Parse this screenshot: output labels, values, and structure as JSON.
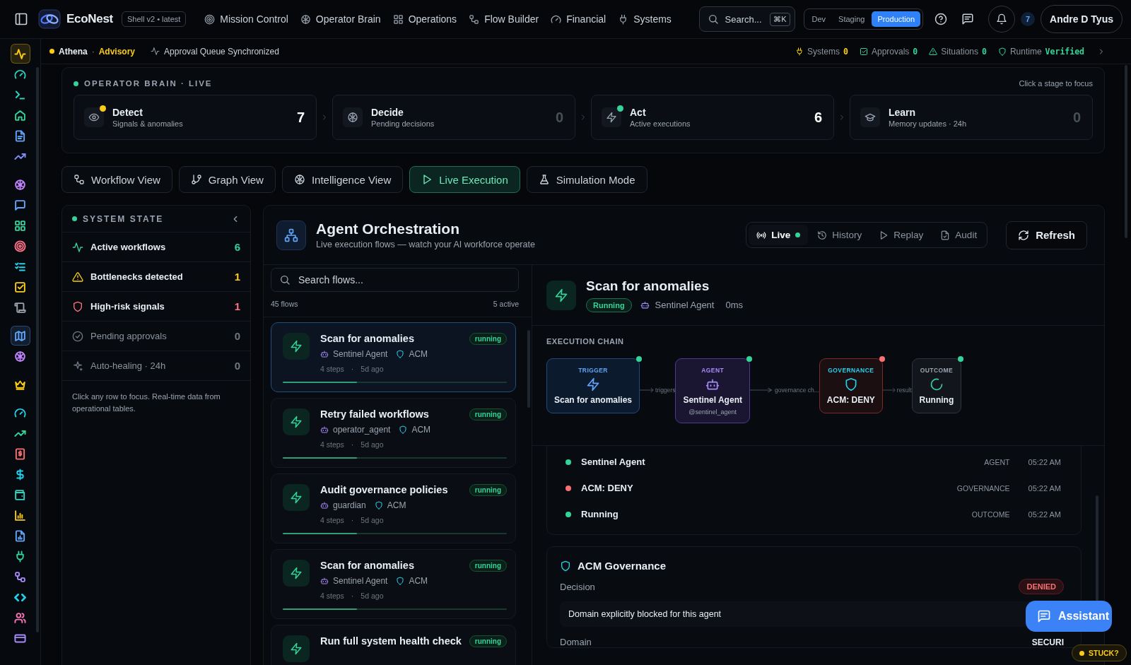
{
  "header": {
    "brand": "EcoNest",
    "build_badge": "Shell v2 • latest",
    "nav": [
      {
        "label": "Mission Control"
      },
      {
        "label": "Operator Brain"
      },
      {
        "label": "Operations"
      },
      {
        "label": "Flow Builder"
      },
      {
        "label": "Financial"
      },
      {
        "label": "Systems"
      }
    ],
    "search": {
      "placeholder": "Search...",
      "shortcut": "⌘K"
    },
    "environments": [
      {
        "label": "Dev",
        "selected": false
      },
      {
        "label": "Staging",
        "selected": false
      },
      {
        "label": "Production",
        "selected": true
      }
    ],
    "notification_count": "7",
    "user": "Andre D Tyus"
  },
  "rail": {
    "groups": [
      {
        "items": [
          {
            "color": "#facc15",
            "selected": true
          },
          {
            "color": "#2dd4bf",
            "selected": false
          },
          {
            "color": "#2dd4bf",
            "selected": false
          },
          {
            "color": "#34d399",
            "selected": false
          },
          {
            "color": "#60a5fa",
            "selected": false
          },
          {
            "color": "#818cf8",
            "selected": false
          }
        ]
      },
      {
        "items": [
          {
            "color": "#c084fc",
            "selected": false
          },
          {
            "color": "#60a5fa",
            "selected": false
          },
          {
            "color": "#34d399",
            "selected": false
          },
          {
            "color": "#fb7185",
            "selected": false
          },
          {
            "color": "#22d3ee",
            "selected": false
          },
          {
            "color": "#facc15",
            "selected": false
          },
          {
            "color": "#9ca3af",
            "selected": false
          }
        ]
      },
      {
        "items": [
          {
            "color": "#60a5fa",
            "selected": true
          },
          {
            "color": "#c084fc",
            "selected": false
          }
        ]
      },
      {
        "items": [
          {
            "color": "#facc15",
            "selected": false
          }
        ]
      },
      {
        "items": [
          {
            "color": "#22d3ee",
            "selected": false
          },
          {
            "color": "#34d399",
            "selected": false
          },
          {
            "color": "#f87171",
            "selected": false
          },
          {
            "color": "#22d3ee",
            "selected": false
          },
          {
            "color": "#2dd4bf",
            "selected": false
          },
          {
            "color": "#facc15",
            "selected": false
          },
          {
            "color": "#60a5fa",
            "selected": false
          },
          {
            "color": "#34d399",
            "selected": false
          },
          {
            "color": "#a78bfa",
            "selected": false
          },
          {
            "color": "#22d3ee",
            "selected": false
          },
          {
            "color": "#f472b6",
            "selected": false
          },
          {
            "color": "#a78bfa",
            "selected": false
          }
        ]
      }
    ]
  },
  "status": {
    "agent": "Athena",
    "separator": "·",
    "mode": "Advisory",
    "sync": "Approval Queue Synchronized",
    "counters": [
      {
        "label": "Systems",
        "value": "0",
        "color": "#facc15"
      },
      {
        "label": "Approvals",
        "value": "0",
        "color": "#34d399"
      },
      {
        "label": "Situations",
        "value": "0",
        "color": "#34d399"
      },
      {
        "label": "Runtime",
        "value": "Verified",
        "color": "#34d399"
      }
    ]
  },
  "brain": {
    "title": "OPERATOR BRAIN · LIVE",
    "hint": "Click a stage to focus",
    "stages": [
      {
        "title": "Detect",
        "subtitle": "Signals & anomalies",
        "count": "7",
        "active": true,
        "color": "#facc15"
      },
      {
        "title": "Decide",
        "subtitle": "Pending decisions",
        "count": "0",
        "active": false
      },
      {
        "title": "Act",
        "subtitle": "Active executions",
        "count": "6",
        "active": true,
        "color": "#34d399"
      },
      {
        "title": "Learn",
        "subtitle": "Memory updates · 24h",
        "count": "0",
        "active": false
      }
    ]
  },
  "views": [
    {
      "label": "Workflow View",
      "selected": false
    },
    {
      "label": "Graph View",
      "selected": false
    },
    {
      "label": "Intelligence View",
      "selected": false
    },
    {
      "label": "Live Execution",
      "selected": true
    },
    {
      "label": "Simulation Mode",
      "selected": false
    }
  ],
  "system_state": {
    "title": "SYSTEM STATE",
    "rows": [
      {
        "label": "Active workflows",
        "count": "6",
        "color": "#34d399",
        "highlighted": true
      },
      {
        "label": "Bottlenecks detected",
        "count": "1",
        "color": "#facc15",
        "highlighted": true
      },
      {
        "label": "High-risk signals",
        "count": "1",
        "color": "#fb7185",
        "highlighted": true
      },
      {
        "label": "Pending approvals",
        "count": "0",
        "color": "#6e7681",
        "highlighted": false
      },
      {
        "label": "Auto-healing · 24h",
        "count": "0",
        "color": "#6e7681",
        "highlighted": false
      }
    ],
    "note": "Click any row to focus. Real-time data from operational tables."
  },
  "orchestration": {
    "title": "Agent Orchestration",
    "subtitle": "Live execution flows — watch your AI workforce operate",
    "modes": [
      {
        "label": "Live",
        "selected": true
      },
      {
        "label": "History",
        "selected": false
      },
      {
        "label": "Replay",
        "selected": false
      },
      {
        "label": "Audit",
        "selected": false
      }
    ],
    "refresh": "Refresh"
  },
  "flows": {
    "search_placeholder": "Search flows...",
    "total": "45 flows",
    "active": "5 active",
    "items": [
      {
        "title": "Scan for anomalies",
        "status": "running",
        "agent": "Sentinel Agent",
        "policy": "ACM",
        "steps": "4 steps",
        "separator": "·",
        "age": "5d ago",
        "level": 0.33,
        "selected": true
      },
      {
        "title": "Retry failed workflows",
        "status": "running",
        "agent": "operator_agent",
        "policy": "ACM",
        "steps": "4 steps",
        "separator": "·",
        "age": "5d ago",
        "level": 0.33,
        "selected": false
      },
      {
        "title": "Audit governance policies",
        "status": "running",
        "agent": "guardian",
        "policy": "ACM",
        "steps": "4 steps",
        "separator": "·",
        "age": "5d ago",
        "level": 0.33,
        "selected": false
      },
      {
        "title": "Scan for anomalies",
        "status": "running",
        "agent": "Sentinel Agent",
        "policy": "ACM",
        "steps": "4 steps",
        "separator": "·",
        "age": "5d ago",
        "level": 0.33,
        "selected": false
      },
      {
        "title": "Run full system health check",
        "status": "running",
        "selected": false
      }
    ]
  },
  "detail": {
    "title": "Scan for anomalies",
    "status": "Running",
    "agent": "Sentinel Agent",
    "duration": "0ms",
    "chain_title": "EXECUTION CHAIN",
    "chain": [
      {
        "kind": "trigger",
        "label": "TRIGGER",
        "title": "Scan for anomalies",
        "color": "#34d399"
      },
      {
        "kind": "agent",
        "label": "AGENT",
        "title": "Sentinel Agent",
        "handle": "@sentinel_agent",
        "color": "#34d399"
      },
      {
        "kind": "governance",
        "label": "GOVERNANCE",
        "title": "ACM: DENY",
        "color": "#f87171"
      },
      {
        "kind": "outcome",
        "label": "OUTCOME",
        "title": "Running",
        "color": "#34d399"
      }
    ],
    "links": [
      "triggers",
      "governance ch...",
      "result"
    ],
    "timeline": [
      {
        "title": "Sentinel Agent",
        "type": "AGENT",
        "time": "05:22 AM",
        "color": "#34d399"
      },
      {
        "title": "ACM: DENY",
        "type": "GOVERNANCE",
        "time": "05:22 AM",
        "color": "#f87171"
      },
      {
        "title": "Running",
        "type": "OUTCOME",
        "time": "05:22 AM",
        "color": "#34d399"
      }
    ],
    "governance": {
      "title": "ACM Governance",
      "decision_label": "Decision",
      "decision": "DENIED",
      "reason": "Domain explicitly blocked for this agent",
      "domain_label": "Domain",
      "domain": "SECURI"
    }
  },
  "assistant": {
    "label": "Assistant"
  },
  "stuck": {
    "label": "STUCK?"
  }
}
